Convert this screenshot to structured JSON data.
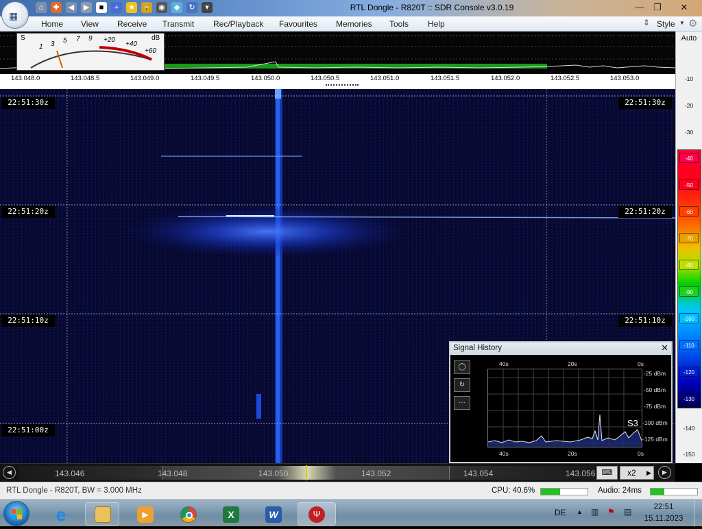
{
  "window": {
    "title": "RTL Dongle - R820T :: SDR Console v3.0.19"
  },
  "quick_access": [
    "home-icon",
    "help-icon",
    "back-icon",
    "play-icon",
    "stop-icon",
    "add-icon",
    "star-icon",
    "lock-icon",
    "camera-icon",
    "drop-icon",
    "refresh-icon",
    "customize-icon"
  ],
  "menu": {
    "items": [
      "Home",
      "View",
      "Receive",
      "Transmit",
      "Rec/Playback",
      "Favourites",
      "Memories",
      "Tools",
      "Help"
    ],
    "style_label": "Style"
  },
  "smeter": {
    "unit_label": "S",
    "db_label": "dB",
    "scale": [
      "1",
      "3",
      "5",
      "7",
      "9",
      "+20",
      "+40",
      "+60"
    ]
  },
  "spectrum": {
    "freq_ticks": [
      "143.048.0",
      "143.048.5",
      "143.049.0",
      "143.049.5",
      "143.050.0",
      "143.050.5",
      "143.051.0",
      "143.051.5",
      "143.052.0",
      "143.052.5",
      "143.053.0"
    ]
  },
  "waterfall": {
    "timestamps": [
      "22:51:30z",
      "22:51:20z",
      "22:51:10z",
      "22:51:00z"
    ],
    "timestamps_right": [
      "22:51:30z",
      "22:51:20z",
      "22:51:10z"
    ]
  },
  "dbscale": {
    "auto_label": "Auto",
    "ticks_top": [
      "-10",
      "-20",
      "-30"
    ],
    "swatches": [
      {
        "label": "-40",
        "color": "#ff0050"
      },
      {
        "label": "-50",
        "color": "#ff0020"
      },
      {
        "label": "-60",
        "color": "#ff4000"
      },
      {
        "label": "-70",
        "color": "#e8a000"
      },
      {
        "label": "-80",
        "color": "#c0e000"
      },
      {
        "label": "-90",
        "color": "#20d020"
      },
      {
        "label": "-100",
        "color": "#00c0ff"
      },
      {
        "label": "-110",
        "color": "#0070ff"
      },
      {
        "label": "-120",
        "color": "#0020d0"
      },
      {
        "label": "-130",
        "color": "#000080"
      }
    ],
    "ticks_bottom": [
      "-140",
      "-150"
    ]
  },
  "signal_history": {
    "title": "Signal History",
    "top_time_labels": [
      "40s",
      "20s",
      "0s"
    ],
    "bottom_time_labels": [
      "40s",
      "20s",
      "0s"
    ],
    "db_labels": [
      "-25 dBm",
      "-50 dBm",
      "-75 dBm",
      "-100 dBm",
      "-125 dBm"
    ],
    "s_reading": "S3"
  },
  "tuning": {
    "labels": [
      "143.046",
      "143.048",
      "143.050",
      "143.052",
      "143.054",
      "143.056"
    ],
    "zoom": "x2"
  },
  "status": {
    "device": "RTL Dongle - R820T, BW = 3.000 MHz",
    "cpu": "CPU: 40.6%",
    "cpu_level": 0.406,
    "audio": "Audio: 24ms",
    "audio_level": 0.3
  },
  "taskbar": {
    "apps": [
      "internet-explorer",
      "file-explorer",
      "media-player",
      "chrome",
      "excel",
      "word",
      "sdr-console"
    ],
    "lang": "DE",
    "time": "22:51",
    "date": "15.11.2023"
  }
}
